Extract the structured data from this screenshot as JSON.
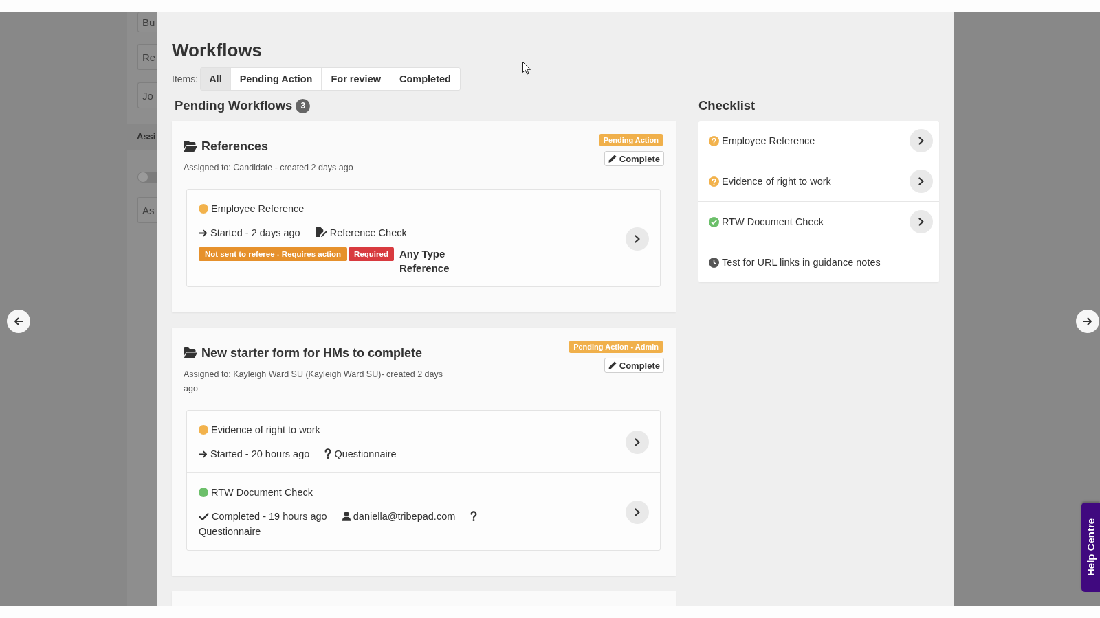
{
  "background_page": {
    "buttons": [
      "Bu",
      "Re",
      "Jo"
    ],
    "heading": "Assi",
    "toggle": {
      "on": false
    },
    "field": {
      "value": "As"
    }
  },
  "modal": {
    "title": "Workflows",
    "filter": {
      "label": "Items:",
      "tabs": [
        {
          "label": "All",
          "selected": true
        },
        {
          "label": "Pending Action",
          "selected": false
        },
        {
          "label": "For review",
          "selected": false
        },
        {
          "label": "Completed",
          "selected": false
        }
      ]
    },
    "workflows": {
      "heading": "Pending Workflows",
      "count": "3",
      "cards": [
        {
          "title": "References",
          "assigned": "Assigned to: Candidate - created 2 days ago",
          "status": "Pending Action",
          "action": "Complete",
          "tasks": [
            {
              "name": "Employee Reference",
              "color": "#f2b24c",
              "progress": {
                "kind": "started",
                "text": "Started - 2 days ago"
              },
              "type": {
                "kind": "reference",
                "text": "Reference Check"
              },
              "badges": [
                {
                  "text": "Not sent to referee - Requires action",
                  "kind": "warning"
                },
                {
                  "text": "Required",
                  "kind": "danger"
                }
              ],
              "note": "Any Type Reference"
            }
          ]
        },
        {
          "title": "New starter form for HMs to complete",
          "assigned": "Assigned to: Kayleigh Ward SU (Kayleigh Ward SU)- created 2 days ago",
          "status": "Pending Action - Admin",
          "action": "Complete",
          "tasks": [
            {
              "name": "Evidence of right to work",
              "color": "#f2b24c",
              "progress": {
                "kind": "started",
                "text": "Started - 20 hours ago"
              },
              "type": {
                "kind": "questionnaire",
                "text": "Questionnaire"
              }
            },
            {
              "name": "RTW Document Check",
              "color": "#6cbf6a",
              "progress": {
                "kind": "completed",
                "text": "Completed - 19 hours ago"
              },
              "assignee": "daniella@tribepad.com",
              "type": {
                "kind": "questionnaire",
                "text": "Questionnaire"
              }
            }
          ]
        }
      ]
    },
    "checklist": {
      "heading": "Checklist",
      "items": [
        {
          "label": "Employee Reference",
          "kind": "pending",
          "openable": true
        },
        {
          "label": "Evidence of right to work",
          "kind": "pending",
          "openable": true
        },
        {
          "label": "RTW Document Check",
          "kind": "complete",
          "openable": true
        },
        {
          "label": "Test for URL links in guidance notes",
          "kind": "waiting",
          "openable": false
        }
      ]
    }
  },
  "help_tab": "Help Centre"
}
